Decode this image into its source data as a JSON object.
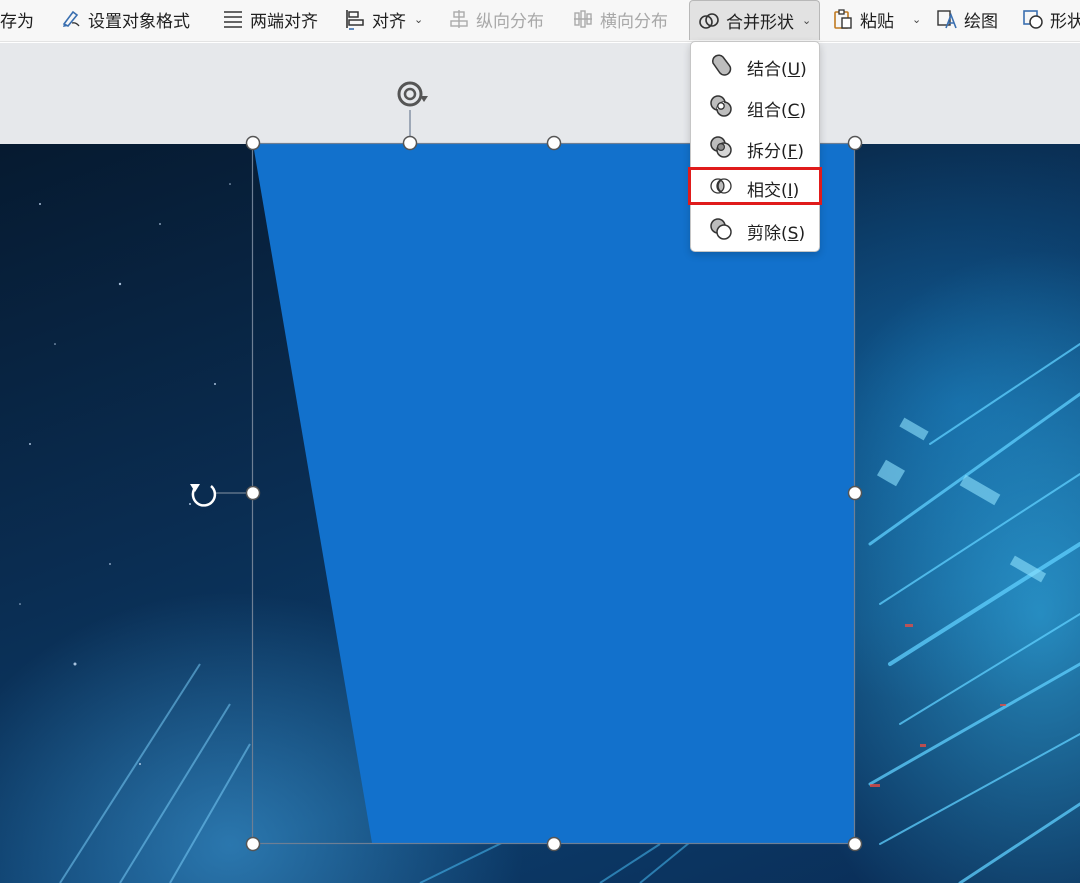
{
  "toolbar": {
    "items": [
      {
        "label": "存为",
        "icon": "none"
      },
      {
        "label": "设置对象格式",
        "icon": "format-object-icon"
      },
      {
        "label": "两端对齐",
        "icon": "justify-icon"
      },
      {
        "label": "对齐",
        "icon": "align-icon"
      },
      {
        "label": "纵向分布",
        "icon": "distribute-vertical-icon"
      },
      {
        "label": "横向分布",
        "icon": "distribute-horizontal-icon"
      },
      {
        "label": "合并形状",
        "icon": "merge-shapes-icon"
      },
      {
        "label": "粘贴",
        "icon": "paste-icon"
      },
      {
        "label": "绘图",
        "icon": "draw-icon"
      },
      {
        "label": "形状",
        "icon": "shape-icon"
      }
    ]
  },
  "merge_menu": {
    "items": [
      {
        "text": "结合(",
        "key": "U",
        "close": ")",
        "icon": "union-shapes-icon"
      },
      {
        "text": "组合(",
        "key": "C",
        "close": ")",
        "icon": "combine-shapes-icon"
      },
      {
        "text": "拆分(",
        "key": "F",
        "close": ")",
        "icon": "fragment-shapes-icon"
      },
      {
        "text": "相交(",
        "key": "I",
        "close": ")",
        "icon": "intersect-shapes-icon"
      },
      {
        "text": "剪除(",
        "key": "S",
        "close": ")",
        "icon": "subtract-shapes-icon"
      }
    ],
    "highlighted_item": "相交(I)"
  },
  "colors": {
    "shape_fill": "#1271cc",
    "highlight_border": "#e01b1b",
    "toolbar_bg": "#f7f7f7",
    "workarea_bg": "#e6e8eb"
  }
}
